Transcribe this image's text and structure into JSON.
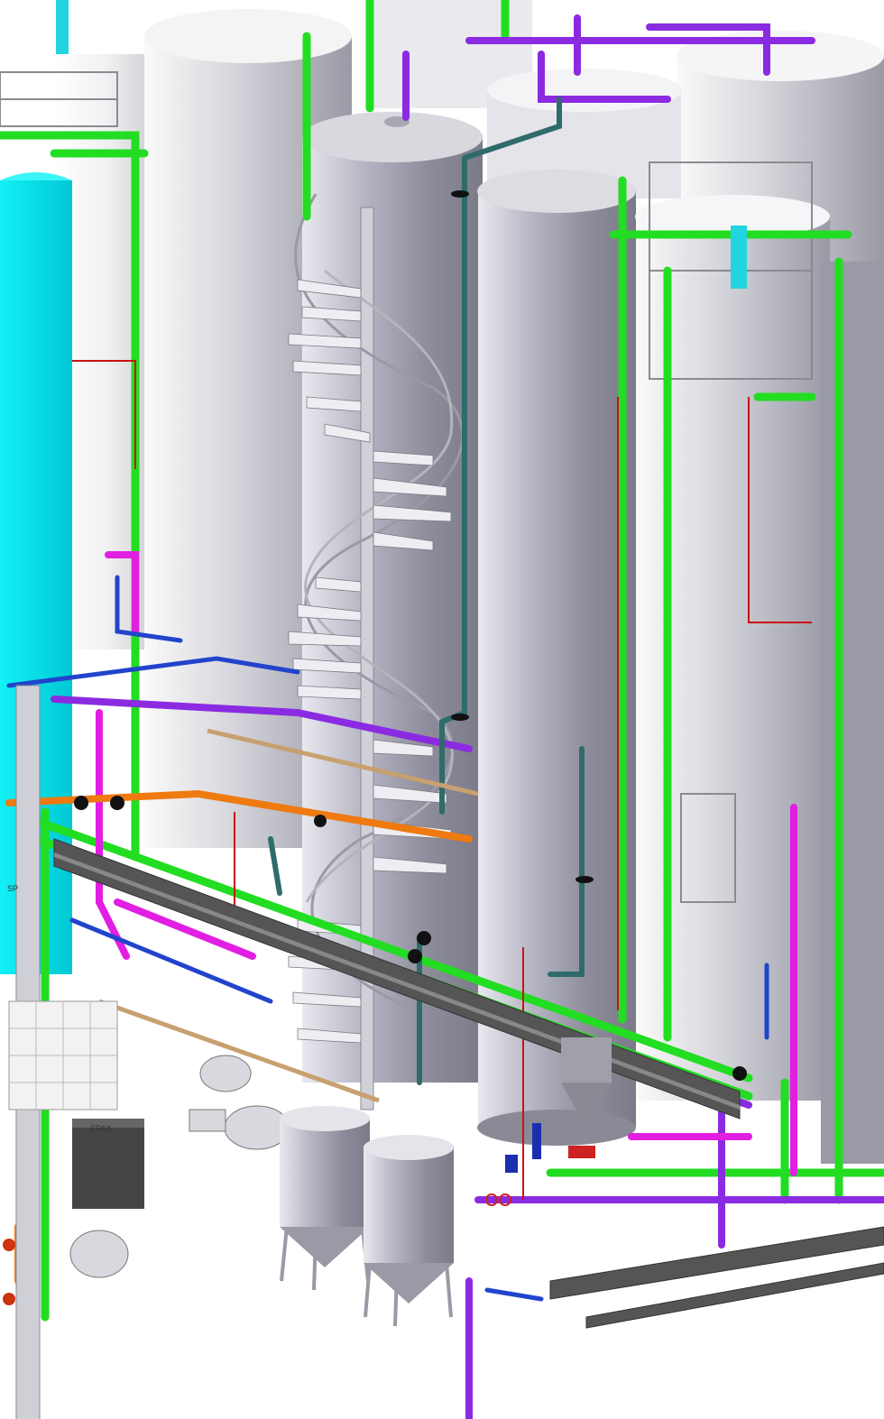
{
  "scene": {
    "colors": {
      "tank_light": "#f4f4f6",
      "tank_mid": "#c9c9d2",
      "tank_dark": "#8f8f99",
      "tank_cyan": "#00e5ee",
      "pipe_green": "#22dd22",
      "pipe_purple": "#8a2be2",
      "pipe_magenta": "#e21ee2",
      "pipe_blue": "#2244cc",
      "pipe_teal": "#2f6b6b",
      "pipe_orange": "#ee7a10",
      "pipe_red": "#cc1111",
      "pipe_tan": "#c8a070",
      "steel_grey": "#555555"
    },
    "labels": {
      "sp_tag": "SP",
      "equipment_tag": "EPAX"
    }
  }
}
